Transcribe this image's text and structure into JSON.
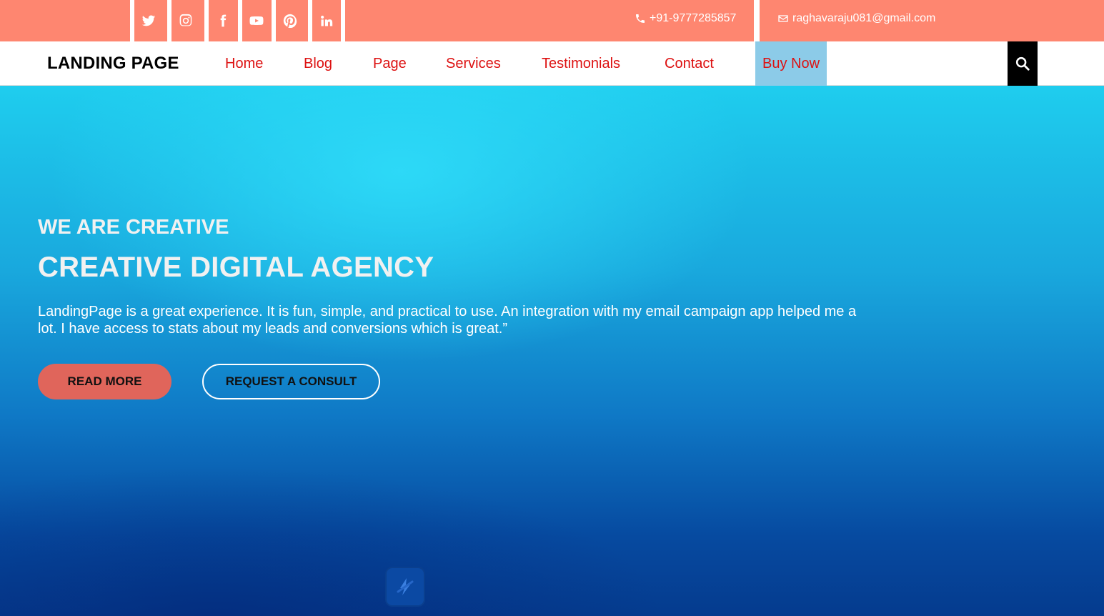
{
  "topbar": {
    "social": [
      {
        "icon": "twitter-icon"
      },
      {
        "icon": "instagram-icon"
      },
      {
        "icon": "facebook-icon"
      },
      {
        "icon": "youtube-icon"
      },
      {
        "icon": "pinterest-icon"
      },
      {
        "icon": "linkedin-icon"
      }
    ],
    "phone": "+91-9777285857",
    "email": "raghavaraju081@gmail.com",
    "background_color": "#fe8670"
  },
  "nav": {
    "logo": "LANDING PAGE",
    "items": [
      "Home",
      "Blog",
      "Page",
      "Services",
      "Testimonials",
      "Contact"
    ],
    "buy_now": "Buy Now",
    "link_color": "#dd1111",
    "buy_now_bg": "#8ccbe8",
    "search_icon": "search-icon"
  },
  "hero": {
    "eyebrow": "WE ARE CREATIVE",
    "headline": "CREATIVE DIGITAL AGENCY",
    "lead": "LandingPage is a great experience. It is fun, simple, and practical to use. An integration with my email campaign app helped me a lot. I have access to stats about my leads and conversions which is great.”",
    "read_more": "READ MORE",
    "request_consult": "REQUEST A CONSULT",
    "read_more_color": "#e0655b"
  }
}
